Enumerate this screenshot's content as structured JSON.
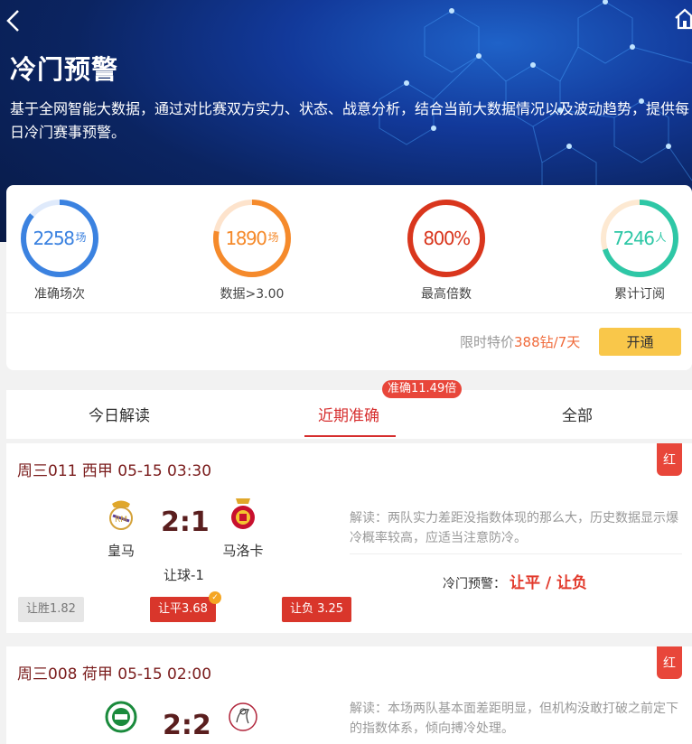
{
  "header": {
    "title": "冷门预警",
    "description": "基于全网智能大数据，通过对比赛双方实力、状态、战意分析，结合当前大数据情况以及波动趋势，提供每日冷门赛事预警。"
  },
  "stats": [
    {
      "value": "2258",
      "unit": "场",
      "label": "准确场次",
      "color": "#3b82e0",
      "fill": 0.86
    },
    {
      "value": "1890",
      "unit": "场",
      "label": "数据>3.00",
      "color": "#f58a2b",
      "fill": 0.78
    },
    {
      "value": "800%",
      "unit": "",
      "label": "最高倍数",
      "color": "#d9361d",
      "fill": 1.0
    },
    {
      "value": "7246",
      "unit": "人",
      "label": "累计订阅",
      "color": "#2ec7a6",
      "fill": 0.7
    }
  ],
  "promo": {
    "prefix": "限时特价",
    "price": "388钻/7天",
    "button": "开通"
  },
  "tabs": {
    "items": [
      "今日解读",
      "近期准确",
      "全部"
    ],
    "active": "近期准确",
    "badge": "准确11.49倍"
  },
  "matches": [
    {
      "header": "周三011 西甲 05-15 03:30",
      "tag": "红",
      "home": "皇马",
      "away": "马洛卡",
      "score": "2:1",
      "handicap": "让球-1",
      "odds": [
        "让胜1.82",
        "让平3.68",
        "让负 3.25"
      ],
      "analysis": "解读：两队实力差距没指数体现的那么大，历史数据显示爆冷概率较高，应适当注意防冷。",
      "warning_label": "冷门预警：",
      "warning_value": "让平 / 让负"
    },
    {
      "header": "周三008 荷甲 05-15 02:00",
      "tag": "红",
      "score": "2:2",
      "analysis": "解读：本场两队基本面差距明显，但机构没敢打破之前定下的指数体系，倾向搏冷处理。"
    }
  ]
}
